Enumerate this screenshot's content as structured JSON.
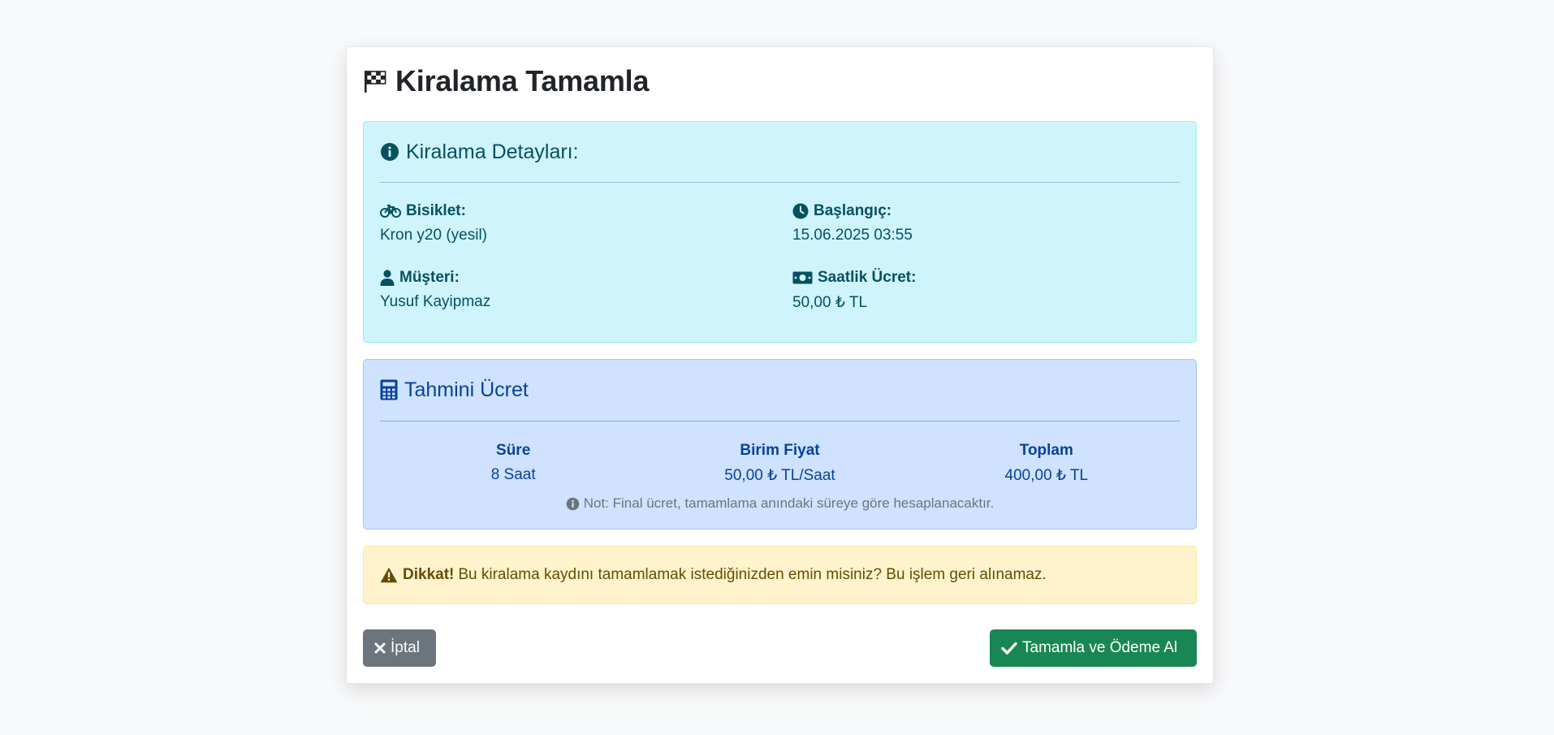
{
  "modal": {
    "title": "Kiralama Tamamla",
    "title_icon": "checkered-flag-icon"
  },
  "details": {
    "heading": "Kiralama Detayları:",
    "heading_icon": "info-circle-icon",
    "bike_label": "Bisiklet:",
    "bike_value": "Kron y20 (yesil)",
    "start_label": "Başlangıç:",
    "start_value": "15.06.2025 03:55",
    "customer_label": "Müşteri:",
    "customer_value": "Yusuf Kayipmaz",
    "rate_label": "Saatlik Ücret:",
    "rate_value": "50,00 ₺ TL",
    "color": "#055160",
    "background": "#cff4fc"
  },
  "estimate": {
    "heading": "Tahmini Ücret",
    "heading_icon": "calculator-icon",
    "duration_label": "Süre",
    "duration_value": "8 Saat",
    "unit_price_label": "Birim Fiyat",
    "unit_price_value": "50,00 ₺ TL/Saat",
    "total_label": "Toplam",
    "total_value": "400,00 ₺ TL",
    "note": "Not: Final ücret, tamamlama anındaki süreye göre hesaplanacaktır.",
    "color": "#084298",
    "background": "#cfe2ff"
  },
  "warning": {
    "strong": "Dikkat!",
    "text": "Bu kiralama kaydını tamamlamak istediğinizden emin misiniz? Bu işlem geri alınamaz.",
    "icon": "warning-triangle-icon",
    "background": "#fff3cd"
  },
  "actions": {
    "cancel_label": "İptal",
    "cancel_icon": "close-icon",
    "confirm_label": "Tamamla ve Ödeme Al",
    "confirm_icon": "check-icon",
    "cancel_color": "#6c757d",
    "confirm_color": "#198754"
  }
}
